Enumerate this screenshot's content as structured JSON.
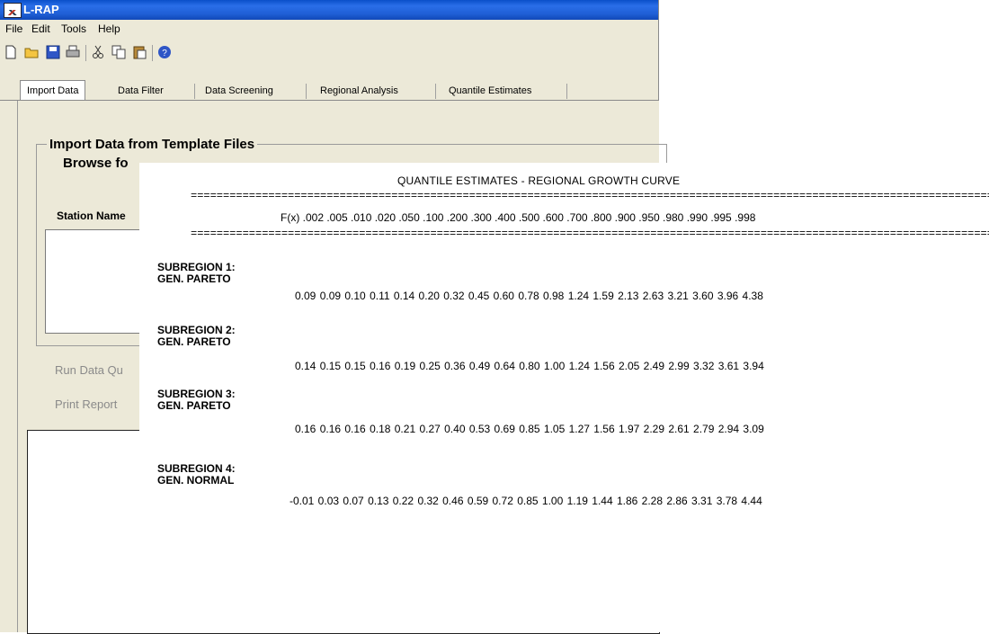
{
  "window": {
    "title": "L-RAP"
  },
  "menu": [
    "File",
    "Edit",
    "Tools",
    "Help"
  ],
  "toolbar": {
    "icons": [
      "new-file-icon",
      "open-folder-icon",
      "save-icon",
      "print-icon",
      "cut-icon",
      "copy-icon",
      "paste-icon",
      "help-icon"
    ]
  },
  "tabs": [
    "Import Data",
    "Data Filter",
    "Data Screening",
    "Regional Analysis",
    "Quantile Estimates"
  ],
  "active_tab": "Import Data",
  "import_panel": {
    "group_title": "Import Data from Template Files",
    "browse_label": "Browse fo",
    "station_name_label": "Station Name",
    "run_button": "Run Data Qu",
    "print_button": "Print Report"
  },
  "report": {
    "title": "QUANTILE ESTIMATES - REGIONAL GROWTH CURVE",
    "fx_header": "F(x) .002 .005 .010 .020 .050 .100 .200 .300 .400 .500 .600 .700 .800 .900 .950 .980 .990 .995 .998",
    "subregions": [
      {
        "name": "SUBREGION 1:",
        "distribution": "GEN. PARETO",
        "values": "0.09 0.09 0.10 0.11 0.14 0.20 0.32 0.45 0.60 0.78 0.98 1.24 1.59 2.13 2.63 3.21 3.60 3.96 4.38"
      },
      {
        "name": "SUBREGION 2:",
        "distribution": "GEN. PARETO",
        "values": "0.14 0.15 0.15 0.16 0.19 0.25 0.36 0.49 0.64 0.80 1.00 1.24 1.56 2.05 2.49 2.99 3.32 3.61 3.94"
      },
      {
        "name": "SUBREGION 3:",
        "distribution": "GEN. PARETO",
        "values": "0.16 0.16 0.16 0.18 0.21 0.27 0.40 0.53 0.69 0.85 1.05 1.27 1.56 1.97 2.29 2.61 2.79 2.94 3.09"
      },
      {
        "name": "SUBREGION 4:",
        "distribution": "GEN. NORMAL",
        "values": "-0.01 0.03 0.07 0.13 0.22 0.32 0.46 0.59 0.72 0.85 1.00 1.19 1.44 1.86 2.28 2.86 3.31 3.78 4.44"
      }
    ]
  }
}
